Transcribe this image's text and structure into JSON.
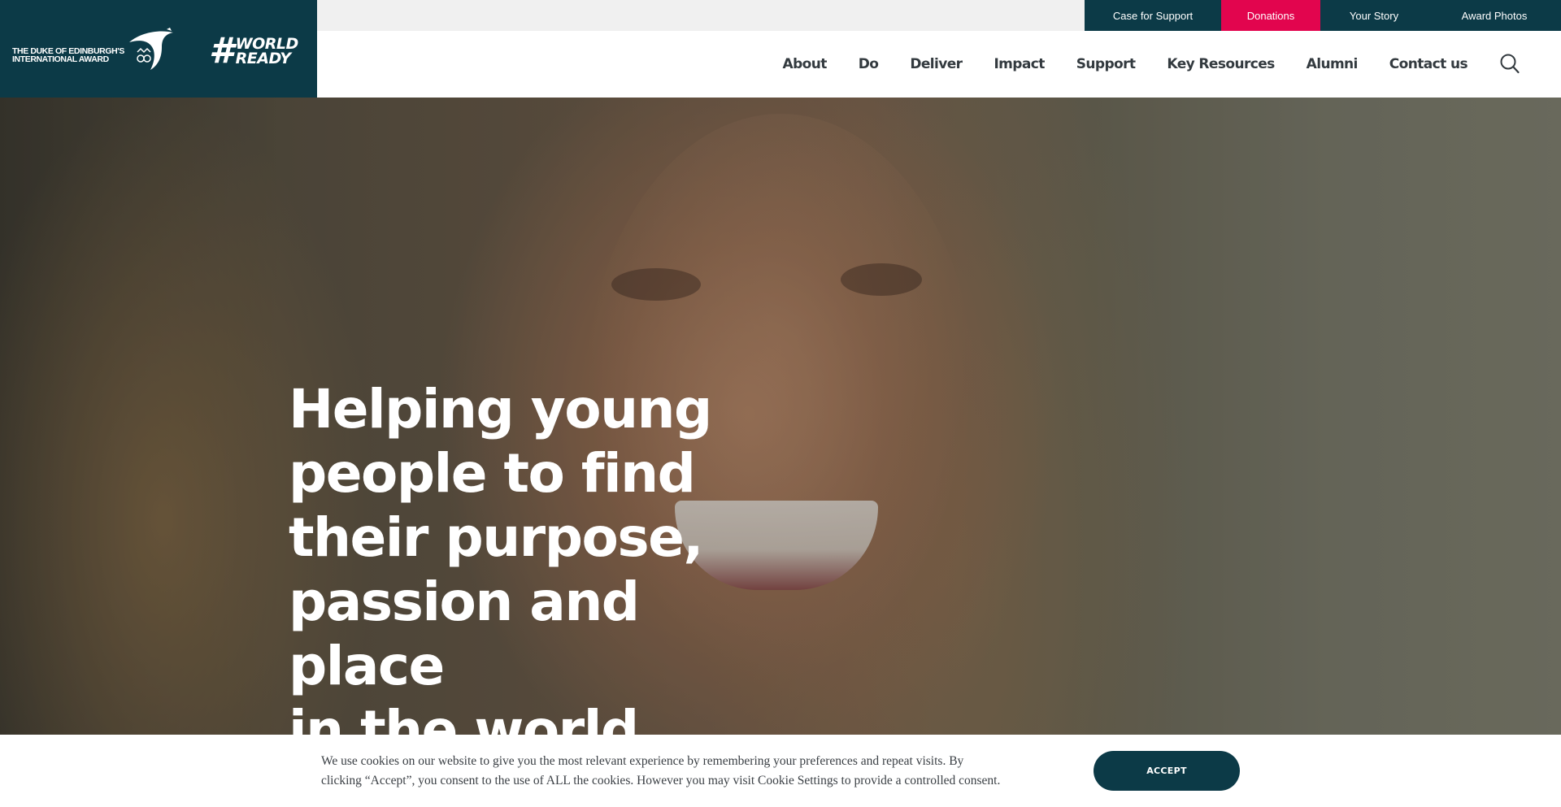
{
  "utility_nav": {
    "items": [
      {
        "label": "Case for Support"
      },
      {
        "label": "Donations"
      },
      {
        "label": "Your Story"
      },
      {
        "label": "Award Photos"
      }
    ]
  },
  "brand": {
    "award_name_line1": "THE DUKE OF EDINBURGH'S",
    "award_name_line2": "INTERNATIONAL AWARD",
    "hashtag_word1": "WORLD",
    "hashtag_word2": "READY",
    "hashtag_symbol": "#"
  },
  "main_nav": {
    "items": [
      {
        "label": "About"
      },
      {
        "label": "Do"
      },
      {
        "label": "Deliver"
      },
      {
        "label": "Impact"
      },
      {
        "label": "Support"
      },
      {
        "label": "Key Resources"
      },
      {
        "label": "Alumni"
      },
      {
        "label": "Contact us"
      }
    ],
    "search_icon": "search-icon"
  },
  "hero": {
    "headline_lines": [
      "Helping young",
      "people to find",
      "their purpose,",
      "passion and place",
      "in the world"
    ]
  },
  "cookie": {
    "message_line1": "We use cookies on our website to give you the most relevant experience by remembering your preferences and repeat visits. By",
    "message_line2": "clicking “Accept”, you consent to the use of ALL the cookies. However you may visit Cookie Settings to provide a controlled consent.",
    "accept_label": "ACCEPT"
  },
  "colors": {
    "brand_dark_teal": "#0c3a47",
    "donations_pink": "#e2054e",
    "utility_bar_bg": "#f0f0f0",
    "nav_text": "#333a3f"
  }
}
